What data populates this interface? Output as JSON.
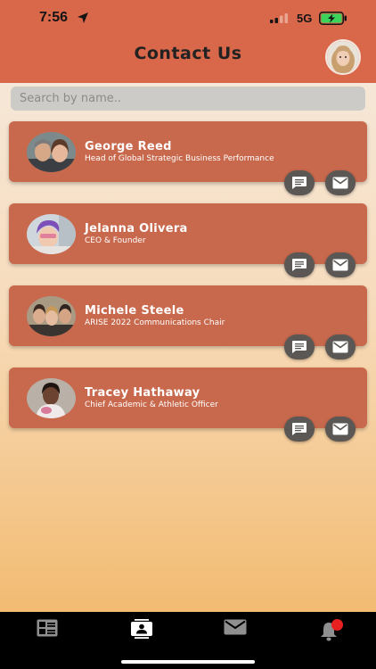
{
  "status_bar": {
    "time": "7:56",
    "network": "5G"
  },
  "header": {
    "title": "Contact Us"
  },
  "search": {
    "placeholder": "Search by name.."
  },
  "contacts": [
    {
      "name": "George Reed",
      "role": "Head of Global Strategic Business Performance"
    },
    {
      "name": "Jelanna Olivera",
      "role": "CEO & Founder"
    },
    {
      "name": "Michele Steele",
      "role": "ARISE 2022 Communications Chair"
    },
    {
      "name": "Tracey Hathaway",
      "role": "Chief Academic & Athletic Officer"
    }
  ],
  "actions": {
    "chat_icon": "chat-bubble-icon",
    "email_icon": "email-icon"
  },
  "tabs": [
    {
      "icon": "dashboard-icon",
      "active": false
    },
    {
      "icon": "contacts-icon",
      "active": true
    },
    {
      "icon": "mail-icon",
      "active": false
    },
    {
      "icon": "bell-icon",
      "active": false,
      "badge": true
    }
  ],
  "colors": {
    "header": "#d9674a",
    "card": "#c8694d",
    "action_button": "#5b5754",
    "tab_bar": "#000000",
    "badge": "#e8201f"
  }
}
